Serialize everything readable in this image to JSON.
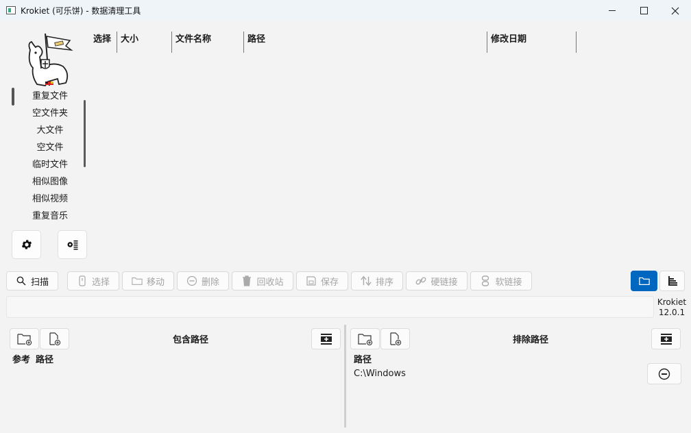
{
  "window": {
    "title": "Krokiet (可乐饼) - 数据清理工具"
  },
  "sidebar": {
    "items": [
      "重复文件",
      "空文件夹",
      "大文件",
      "空文件",
      "临时文件",
      "相似图像",
      "相似视频",
      "重复音乐"
    ],
    "selected_index": 0,
    "settings_icon": "gear-icon",
    "log_icon": "log-settings-icon"
  },
  "results_table": {
    "columns": [
      "选择",
      "大小",
      "文件名称",
      "路径",
      "修改日期"
    ],
    "rows": []
  },
  "toolbar": {
    "scan_label": "扫描",
    "select_label": "选择",
    "move_label": "移动",
    "delete_label": "删除",
    "trash_label": "回收站",
    "save_label": "保存",
    "sort_label": "排序",
    "hardlink_label": "硬链接",
    "symlink_label": "软链接"
  },
  "about": {
    "name": "Krokiet",
    "version": "12.0.1"
  },
  "included_paths": {
    "title": "包含路径",
    "col_reference": "参考",
    "col_path": "路径",
    "items": []
  },
  "excluded_paths": {
    "title": "排除路径",
    "col_path": "路径",
    "items": [
      "C:\\Windows"
    ]
  },
  "colors": {
    "accent": "#0067c0",
    "background": "#f3f3f3",
    "titlebar": "#eff4f9"
  }
}
